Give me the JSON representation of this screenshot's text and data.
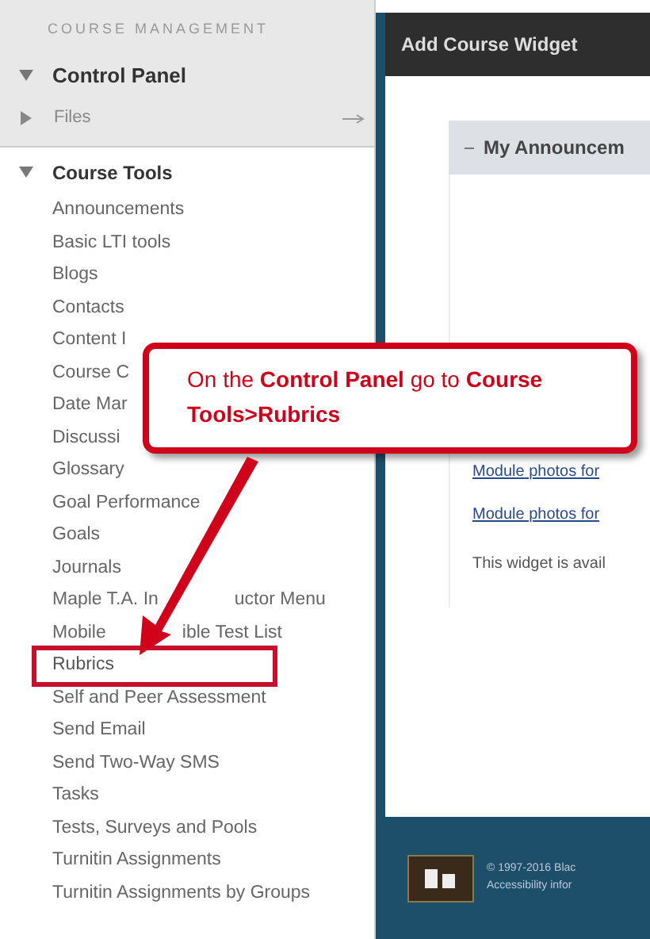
{
  "sidebar": {
    "heading": "COURSE MANAGEMENT",
    "control_panel": {
      "label": "Control Panel",
      "expanded": true
    },
    "files": {
      "label": "Files",
      "expanded": false
    },
    "course_tools": {
      "label": "Course Tools",
      "expanded": true,
      "items": [
        {
          "label": "Announcements",
          "highlighted": false
        },
        {
          "label": "Basic LTI tools",
          "highlighted": false
        },
        {
          "label": "Blogs",
          "highlighted": false
        },
        {
          "label": "Contacts",
          "highlighted": false
        },
        {
          "label": "Content I",
          "highlighted": false
        },
        {
          "label": "Course C",
          "highlighted": false
        },
        {
          "label": "Date Mar",
          "highlighted": false
        },
        {
          "label": "Discussi",
          "highlighted": false
        },
        {
          "label": "Glossary",
          "highlighted": false
        },
        {
          "label": "Goal Performance",
          "highlighted": false
        },
        {
          "label": "Goals",
          "highlighted": false
        },
        {
          "label": "Journals",
          "highlighted": false
        },
        {
          "label": "Maple T.A. In",
          "label_after": "uctor Menu",
          "highlighted": false
        },
        {
          "label": "Mobile",
          "label_after": "ible Test List",
          "highlighted": false
        },
        {
          "label": "Rubrics",
          "highlighted": true
        },
        {
          "label": "Self and Peer Assessment",
          "highlighted": false
        },
        {
          "label": "Send Email",
          "highlighted": false
        },
        {
          "label": "Send Two-Way SMS",
          "highlighted": false
        },
        {
          "label": "Tasks",
          "highlighted": false
        },
        {
          "label": "Tests, Surveys and Pools",
          "highlighted": false
        },
        {
          "label": "Turnitin Assignments",
          "highlighted": false
        },
        {
          "label": "Turnitin Assignments by Groups",
          "highlighted": false
        }
      ]
    }
  },
  "main": {
    "header_title": "Add Course Widget",
    "module": {
      "title": "My Announcem",
      "expanded": true
    },
    "links": [
      "Module photos for",
      "Module photos for"
    ],
    "note": "This widget is avail"
  },
  "footer": {
    "copyright": "© 1997-2016 Blac",
    "accessibility": "Accessibility infor"
  },
  "callout": {
    "text": "On the **Control Panel** go to **Course Tools>Rubrics**"
  }
}
